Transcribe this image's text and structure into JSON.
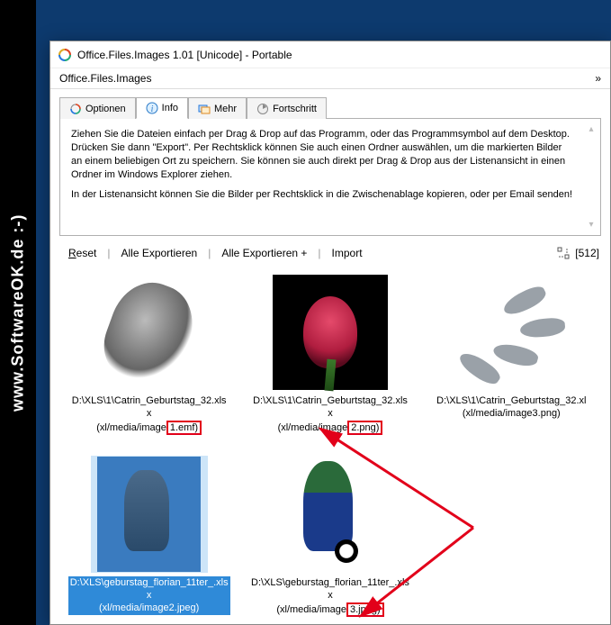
{
  "watermark": "www.SoftwareOK.de :-)",
  "window": {
    "title": "Office.Files.Images 1.01 [Unicode] - Portable"
  },
  "menubar": {
    "app_name": "Office.Files.Images",
    "right_marker": "»"
  },
  "tabs": [
    {
      "label": "Optionen"
    },
    {
      "label": "Info"
    },
    {
      "label": "Mehr"
    },
    {
      "label": "Fortschritt"
    }
  ],
  "info": {
    "p1": "Ziehen Sie die Dateien einfach per Drag & Drop auf das Programm, oder das Programmsymbol auf dem Desktop. Drücken Sie dann \"Export\". Per Rechtsklick können Sie auch einen Ordner auswählen, um die markierten Bilder an einem beliebigen Ort zu speichern. Sie können sie auch direkt per Drag & Drop aus der Listenansicht in einen Ordner im Windows Explorer ziehen.",
    "p2": "In der Listenansicht können Sie die Bilder per Rechtsklick in die Zwischenablage kopieren, oder per Email senden!"
  },
  "toolbar": {
    "reset": "Reset",
    "export_all": "Alle Exportieren",
    "export_all_plus": "Alle Exportieren +",
    "import": "Import",
    "size_value": "[512]"
  },
  "items": [
    {
      "line1": "D:\\XLS\\1\\Catrin_Geburtstag_32.xlsx",
      "line2a": "(xl/media/image",
      "line2b": "1.emf)"
    },
    {
      "line1": "D:\\XLS\\1\\Catrin_Geburtstag_32.xlsx",
      "line2a": "(xl/media/image",
      "line2b": "2.png)"
    },
    {
      "line1": "D:\\XLS\\1\\Catrin_Geburtstag_32.xl",
      "line2a": "(xl/media/image3.png)",
      "line2b": ""
    },
    {
      "line1": "D:\\XLS\\geburstag_florian_11ter_.xlsx",
      "line2a": "(xl/media/image2.jpeg)",
      "line2b": ""
    },
    {
      "line1": "D:\\XLS\\geburstag_florian_11ter_.xlsx",
      "line2a": "(xl/media/image",
      "line2b": "3.jpeg)"
    }
  ]
}
